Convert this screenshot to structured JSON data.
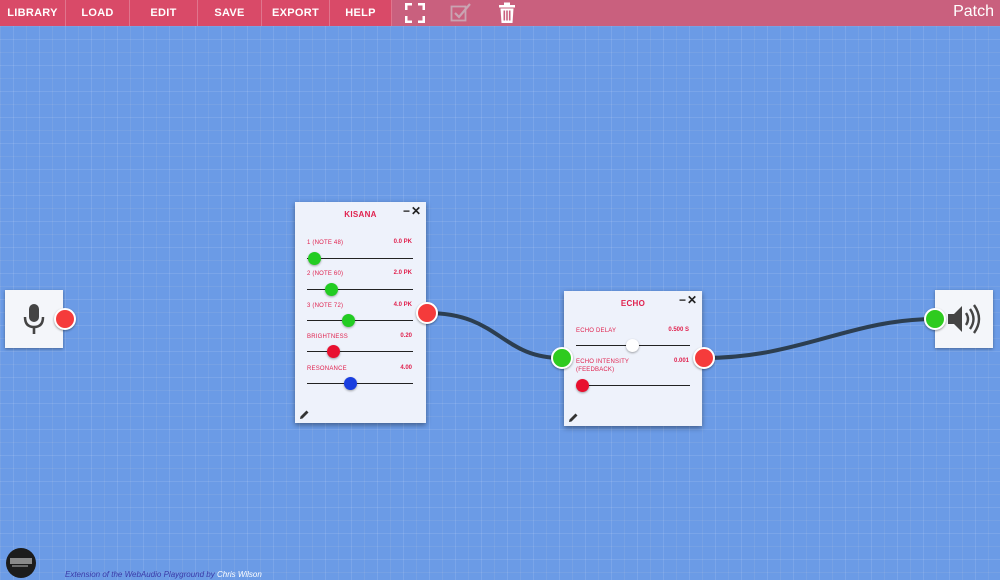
{
  "menu": {
    "library": "LIBRARY",
    "load": "LOAD",
    "edit": "EDIT",
    "save": "SAVE",
    "export": "EXPORT",
    "help": "HELP"
  },
  "toolbar_icons": [
    "fullscreen-icon",
    "checkbox-icon",
    "trash-icon"
  ],
  "patch_title": "Patch",
  "colors": {
    "menu_accent": "#d94a68",
    "menu_bar": "#c9607e",
    "canvas": "#6b9be6",
    "output_port": "#f53b3b",
    "input_port": "#2ecb1f",
    "label_red": "#e0224e",
    "cable": "#2c3e50"
  },
  "input_node": {
    "icon": "microphone-icon"
  },
  "output_node": {
    "icon": "speaker-icon"
  },
  "kisana": {
    "title": "KISANA",
    "params": [
      {
        "label": "1 (NOTE 48)",
        "value": "0.0 PK",
        "thumb_color": "#22cc22"
      },
      {
        "label": "2 (NOTE 60)",
        "value": "2.0 PK",
        "thumb_color": "#22cc22"
      },
      {
        "label": "3 (NOTE 72)",
        "value": "4.0 PK",
        "thumb_color": "#22cc22"
      },
      {
        "label": "BRIGHTNESS",
        "value": "0.20",
        "thumb_color": "#e8102f"
      },
      {
        "label": "RESONANCE",
        "value": "4.00",
        "thumb_color": "#1a3fe0"
      }
    ]
  },
  "echo": {
    "title": "ECHO",
    "params": [
      {
        "label": "ECHO DELAY",
        "value": "0.500 S",
        "thumb_color": "#ffffff"
      },
      {
        "label": "ECHO INTENSITY\n(FEEDBACK)",
        "value": "0.001",
        "thumb_color": "#e8102f"
      }
    ]
  },
  "footer": {
    "text": "Extension of the WebAudio Playground by",
    "author": "Chris Wilson"
  }
}
